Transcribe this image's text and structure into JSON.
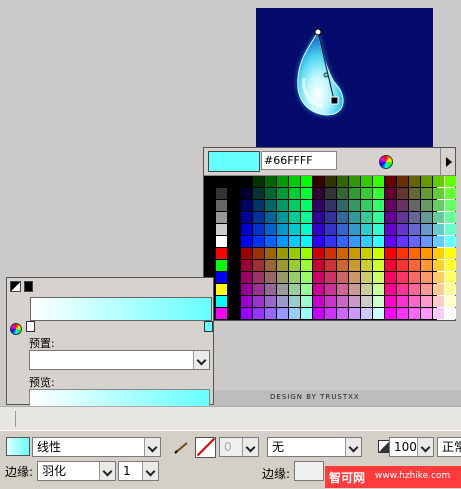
{
  "canvas": {
    "background": "#050a6b",
    "drop_color": "#66ffff"
  },
  "palette": {
    "selected_color": "#66ffff",
    "hex_value": "#66FFFF",
    "wheel_icon": "color-wheel-icon",
    "arrow_icon": "triangle-right-icon"
  },
  "gradient_panel": {
    "start_color": "#ffffff",
    "end_color": "#66ffff",
    "preset_label": "预置:",
    "preset_value": "",
    "preview_label": "预览:"
  },
  "credit": "DESIGN BY TRUSTXX",
  "properties": {
    "fill_type": "线性",
    "edge_label": "边缘:",
    "edge_value": "羽化",
    "edge_amount": "1",
    "stroke_amount": "0",
    "stroke_type": "无",
    "opacity": "100",
    "blend_mode": "正常",
    "stroke_edge_label": "边缘:"
  },
  "watermark": {
    "name": "智可网",
    "url": "www.hzhike.com"
  }
}
